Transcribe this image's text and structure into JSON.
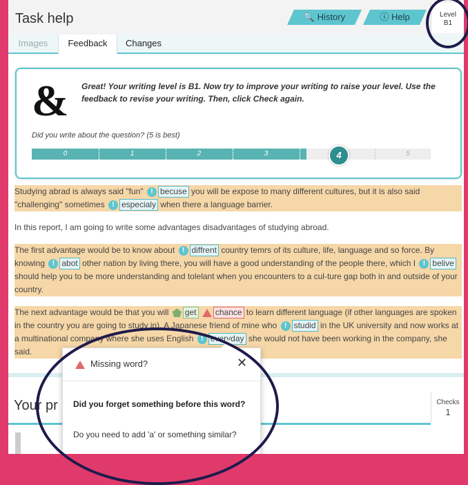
{
  "header": {
    "title": "Task help",
    "history_label": "History",
    "help_label": "Help",
    "level_label": "Level",
    "level_value": "B1"
  },
  "tabs": [
    {
      "label": "Images",
      "active": false
    },
    {
      "label": "Feedback",
      "active": true
    },
    {
      "label": "Changes",
      "active": false
    }
  ],
  "feedback": {
    "message": "Great! Your writing level is B1. Now try to improve your writing to raise your level. Use the feedback to revise your writing. Then, click Check again.",
    "question": "Did you write about the question? (5 is best)",
    "scale": [
      "0",
      "1",
      "2",
      "3",
      "4",
      "5"
    ],
    "score": 4
  },
  "essay": {
    "p1": {
      "t1": "Studying abrad is always said \"fun\"",
      "m1": "becuse",
      "t2": "you will be expose to many different cultures, but it is also said \"challenging\" sometimes",
      "m2": "especialy",
      "t3": "when there a language barrier."
    },
    "p2": "In this report, I am going to write some advantages disadvantages of studying abroad.",
    "p3": {
      "t1": "The first advantage would be to know about",
      "m1": "diffrent",
      "t2": "country temrs of its culture, life, language and so force. By knowing",
      "m2": "abot",
      "t3": "other nation by living there, you will have a good understanding of the people there, which I",
      "m3": "belive",
      "t4": "should help you to be more understanding and tolelant when you encounters to a cul-ture gap both in and outside of your country."
    },
    "p4": {
      "t1": "The next advantage would be that you will",
      "m1": "get",
      "m2": "chance",
      "t2": "to learn different language (if other languages are spoken in the country you are going to study in). A Japanese friend of mine who",
      "m3": "studid",
      "t3": "in the UK university and now works at a multinational company where she uses English",
      "m4": "everyday",
      "t4": "she would not have been working in the company, she said."
    }
  },
  "progress": {
    "title": "Your pr",
    "checks_label": "Checks",
    "checks_value": "1"
  },
  "popup": {
    "heading": "Missing word?",
    "close": "✕",
    "question": "Did you forget something before this word?",
    "hint": "Do you need to add 'a' or something similar?"
  },
  "colors": {
    "accent": "#5ec5cf",
    "highlight": "#f6d7a8",
    "error": "#e06a6a",
    "ring": "#1e1b4b",
    "frame": "#e03a6c"
  }
}
